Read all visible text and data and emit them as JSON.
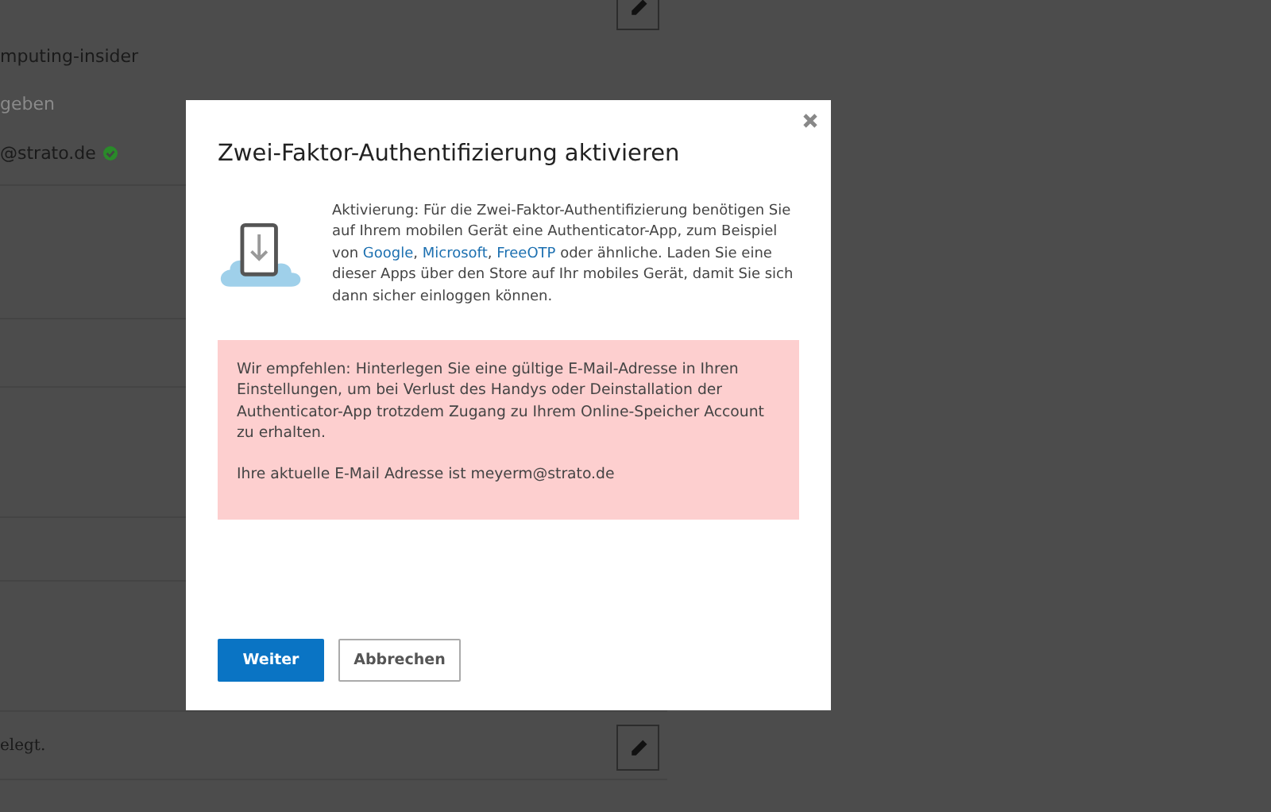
{
  "background": {
    "texts": [
      {
        "kind": "plain",
        "text": "mputing-insider"
      },
      {
        "kind": "faint",
        "text": "geben"
      },
      {
        "kind": "verified",
        "text": "@strato.de"
      }
    ],
    "footer_text": "elegt."
  },
  "dialog": {
    "title": "Zwei-Faktor-Authentifizierung aktivieren",
    "intro": [
      "Aktivierung: Für die Zwei-Faktor-Authentifizierung benötigen Sie auf Ihrem mobilen Gerät eine Authenticator-App, zum Beispiel von ",
      {
        "link": "Google"
      },
      ", ",
      {
        "link": "Microsoft"
      },
      ", ",
      {
        "link": "FreeOTP"
      },
      " oder ähnliche. Laden Sie eine dieser Apps über den Store auf Ihr mobiles Gerät, damit Sie sich dann sicher einloggen können."
    ],
    "warning": [
      "Wir empfehlen: Hinterlegen Sie eine gültige E-Mail-Adresse in Ihren Einstellungen, um bei Verlust des Handys oder Deinstallation der Authenticator-App trotzdem Zugang zu Ihrem Online-Speicher Account zu erhalten.",
      "Ihre aktuelle E-Mail Adresse ist meyerm@strato.de"
    ],
    "buttons": [
      {
        "kind": "primary",
        "label": "Weiter"
      },
      {
        "kind": "secondary",
        "label": "Abbrechen"
      }
    ]
  }
}
